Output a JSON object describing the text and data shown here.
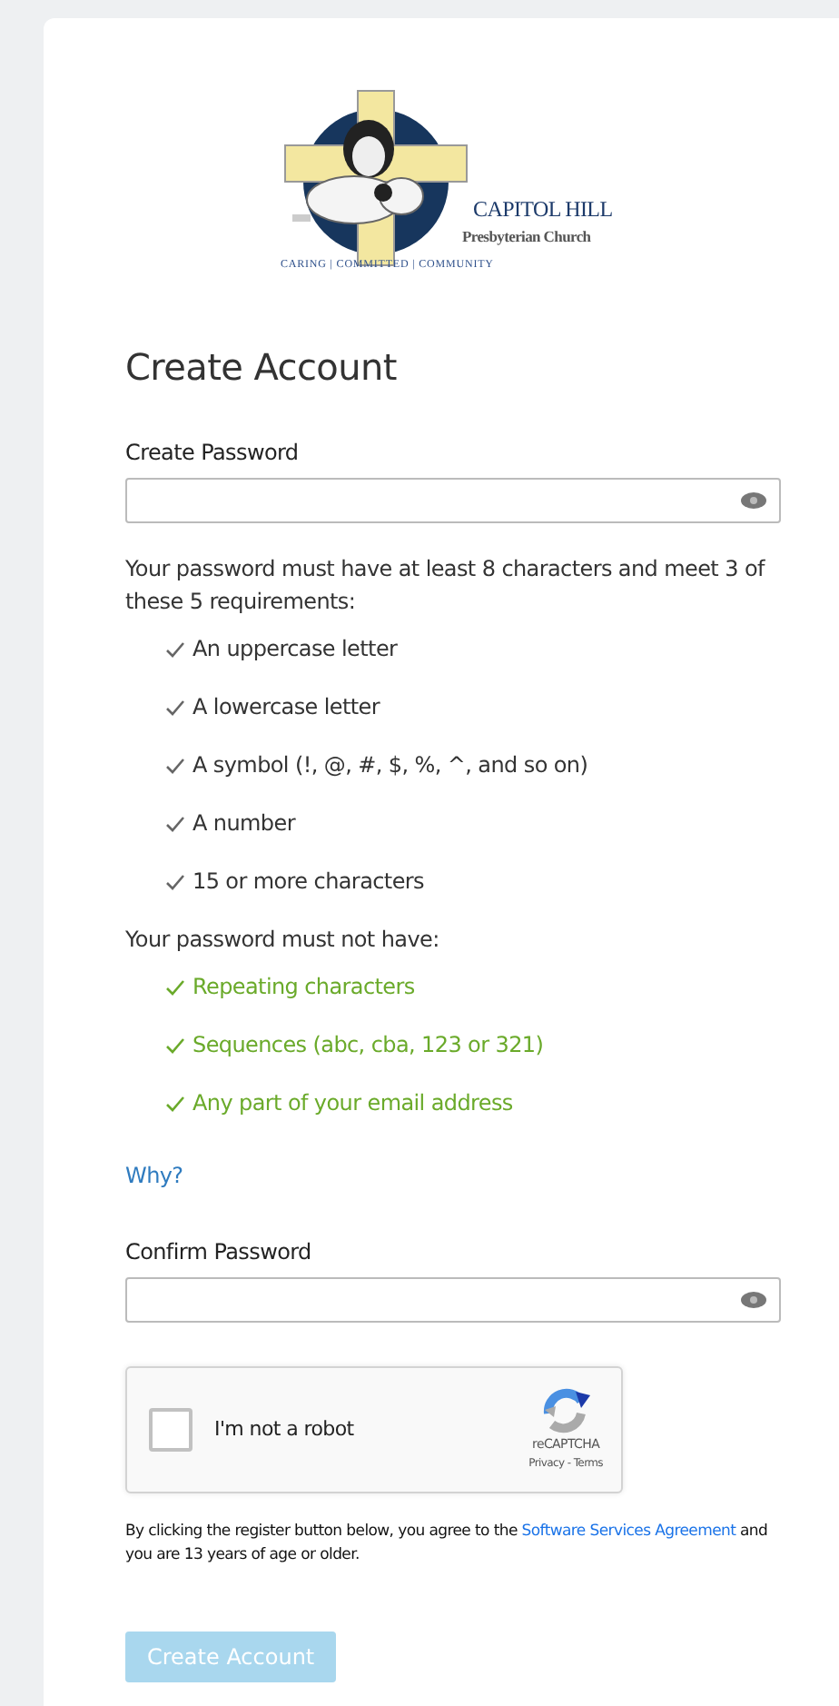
{
  "logo": {
    "name": "CAPITOL HILL",
    "subtitle": "Presbyterian Church",
    "tagline": "CARING | COMMITTED | COMMUNITY"
  },
  "heading": "Create Account",
  "password": {
    "label": "Create Password"
  },
  "requirements": {
    "intro": "Your password must have at least 8 characters and meet 3 of these 5 requirements:",
    "items": [
      {
        "text": "An uppercase letter",
        "satisfied": false
      },
      {
        "text": "A lowercase letter",
        "satisfied": false
      },
      {
        "text": "A symbol (!, @, #, $, %, ^, and so on)",
        "satisfied": false
      },
      {
        "text": "A number",
        "satisfied": false
      },
      {
        "text": "15 or more characters",
        "satisfied": false
      }
    ]
  },
  "restrictions": {
    "intro": "Your password must not have:",
    "items": [
      {
        "text": "Repeating characters",
        "satisfied": true
      },
      {
        "text": "Sequences (abc, cba, 123 or 321)",
        "satisfied": true
      },
      {
        "text": "Any part of your email address",
        "satisfied": true
      }
    ]
  },
  "why_link": "Why?",
  "confirm": {
    "label": "Confirm Password"
  },
  "captcha": {
    "label": "I'm not a robot",
    "checked": false,
    "brand": "reCAPTCHA",
    "links": "Privacy - Terms"
  },
  "agreement": {
    "before": "By clicking the register button below, you agree to the",
    "link": "Software Services Agreement",
    "after": "and you are 13 years of age or older."
  },
  "submit": {
    "label": "Create Account",
    "disabled": true
  }
}
